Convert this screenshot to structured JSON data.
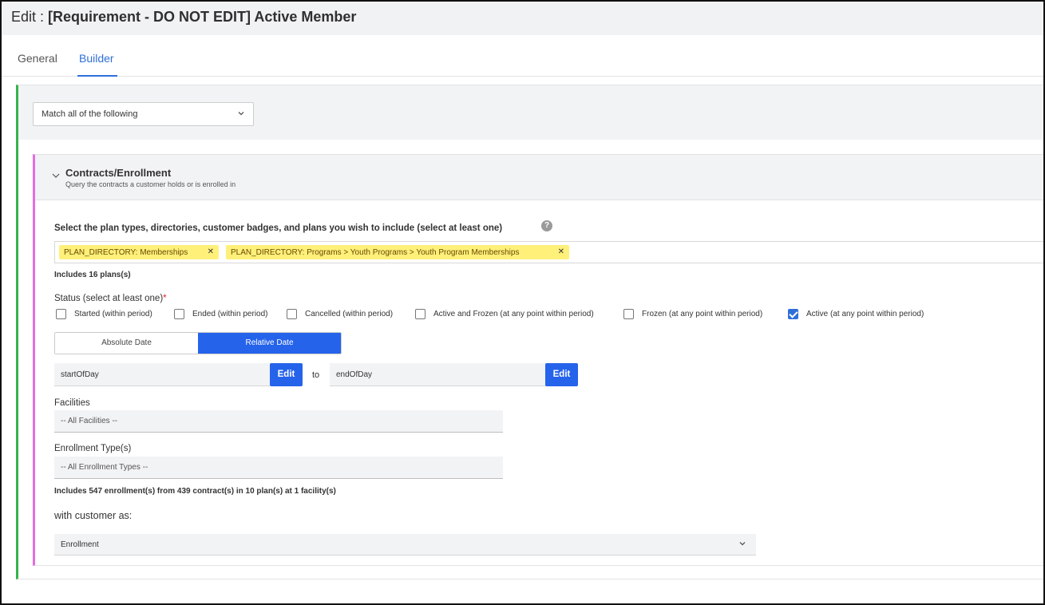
{
  "header": {
    "edit_prefix": "Edit : ",
    "title": "[Requirement - DO NOT EDIT] Active Member"
  },
  "tabs": [
    {
      "label": "General",
      "active": false
    },
    {
      "label": "Builder",
      "active": true
    }
  ],
  "match": {
    "selected": "Match all of the following"
  },
  "section": {
    "title": "Contracts/Enrollment",
    "subtitle": "Query the contracts a customer holds or is enrolled in",
    "plan_label": "Select the plan types, directories, customer badges, and plans you wish to include (select at least one)",
    "help_glyph": "?",
    "tags": [
      {
        "label": "PLAN_DIRECTORY: Memberships"
      },
      {
        "label": "PLAN_DIRECTORY: Programs > Youth Programs > Youth Program Memberships"
      }
    ],
    "tag_close_glyph": "✕",
    "includes_plans": "Includes 16 plans(s)",
    "status_label": "Status (select at least one)",
    "required_mark": "*",
    "statuses": [
      {
        "label": "Started (within period)",
        "checked": false
      },
      {
        "label": "Ended (within period)",
        "checked": false
      },
      {
        "label": "Cancelled (within period)",
        "checked": false
      },
      {
        "label": "Active and Frozen (at any point within period)",
        "checked": false
      },
      {
        "label": "Frozen (at any point within period)",
        "checked": false
      },
      {
        "label": "Active (at any point within period)",
        "checked": true
      }
    ],
    "date_mode": {
      "absolute_label": "Absolute Date",
      "relative_label": "Relative Date",
      "selected": "Relative Date"
    },
    "date_range": {
      "start_value": "startOfDay",
      "end_value": "endOfDay",
      "edit_label": "Edit",
      "to_label": "to"
    },
    "facilities": {
      "label": "Facilities",
      "value": "-- All Facilities --"
    },
    "enrollment_types": {
      "label": "Enrollment Type(s)",
      "value": "-- All Enrollment Types --"
    },
    "enrollment_summary": "Includes 547 enrollment(s) from 439 contract(s) in 10 plan(s) at 1 facility(s)",
    "with_customer_label": "with customer as:",
    "customer_as": "Enrollment"
  },
  "icons": {
    "chevron_down": "chevron-down-icon",
    "collapse": "chevron-down-icon",
    "help": "question-circle-icon",
    "close": "close-icon",
    "check": "checkmark-icon"
  },
  "colors": {
    "accent_blue": "#2563eb",
    "outer_border_green": "#35b34a",
    "inner_border_pink": "#e36ee3",
    "tag_yellow": "#fff07a"
  }
}
